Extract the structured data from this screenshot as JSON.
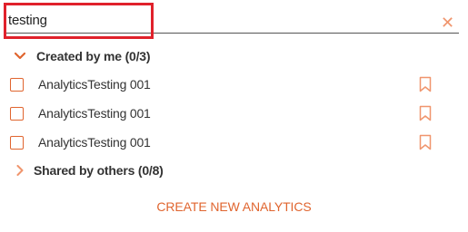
{
  "search": {
    "value": "testing",
    "clear_icon": "close-icon"
  },
  "accent_color": "#e0652f",
  "highlight_color": "#e0212b",
  "groups": [
    {
      "title": "Created by me (0/3)",
      "expanded": true,
      "items": [
        {
          "label": "AnalyticsTesting 001"
        },
        {
          "label": "AnalyticsTesting 001"
        },
        {
          "label": "AnalyticsTesting 001"
        }
      ]
    },
    {
      "title": "Shared by others (0/8)",
      "expanded": false,
      "items": []
    }
  ],
  "actions": {
    "create_label": "CREATE NEW ANALYTICS"
  }
}
